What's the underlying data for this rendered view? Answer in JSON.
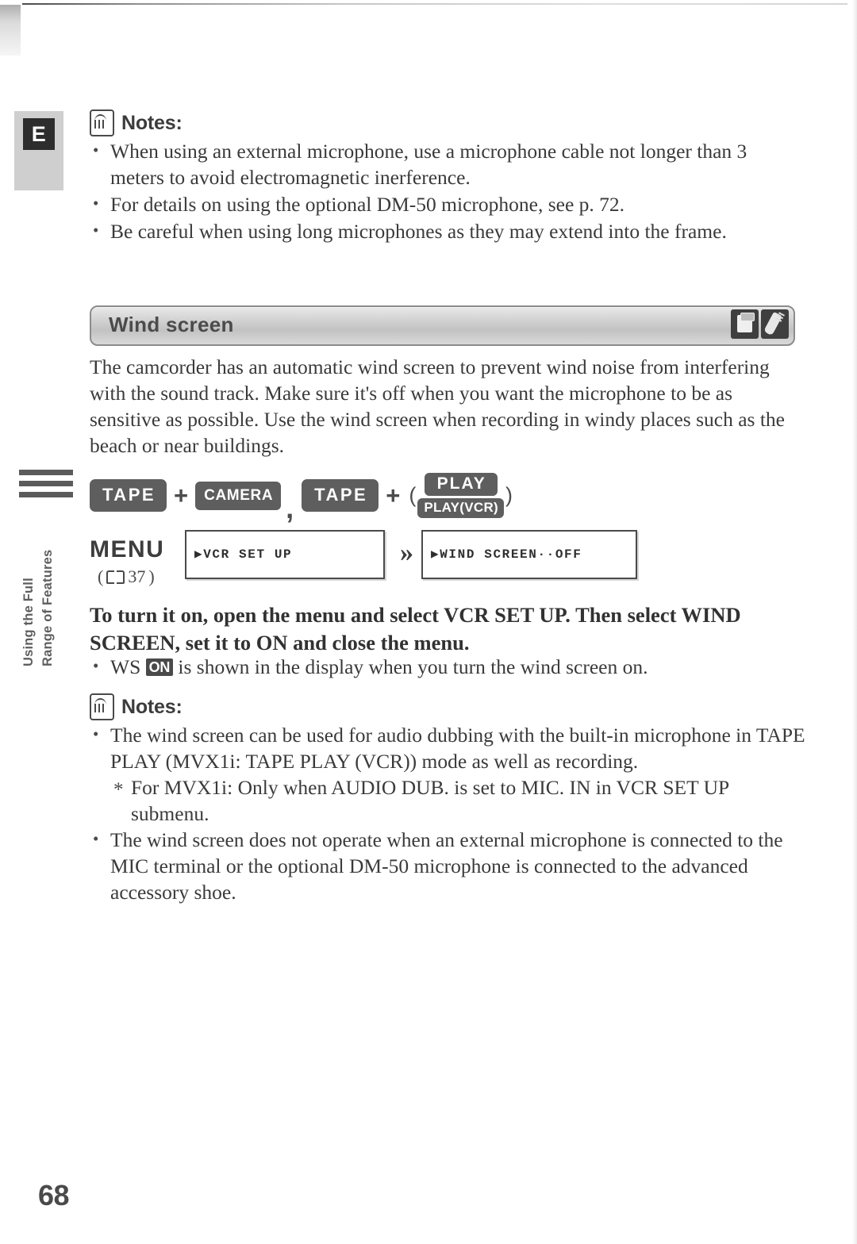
{
  "page": {
    "number": "68",
    "language_badge": "E",
    "side_tab_line1": "Using the Full",
    "side_tab_line2": "Range of Features"
  },
  "notes_top": {
    "heading": "Notes:",
    "icon": "memo-icon",
    "items": [
      "When using an external microphone, use a microphone cable not longer than 3 meters to avoid electromagnetic inerference.",
      "For details on using the optional DM-50 microphone, see p. 72.",
      "Be careful when using long microphones as they may extend into the frame."
    ]
  },
  "section": {
    "title": "Wind screen",
    "mode_icons": [
      "tape-camcorder-icon",
      "remote-wand-icon"
    ]
  },
  "intro": "The camcorder has an automatic wind screen to prevent wind noise from interfering with the sound track. Make sure it's off when you want the microphone to be as sensitive as possible. Use the wind screen when recording in windy places such as the beach or near buildings.",
  "modes": {
    "tape_1": "TAPE",
    "camera": "CAMERA",
    "separator": ",",
    "tape_2": "TAPE",
    "play": "PLAY",
    "play_vcr": "PLAY(VCR)",
    "plus": "+",
    "paren_open": "(",
    "paren_close": ")"
  },
  "menu_flow": {
    "label": "MENU",
    "reference": "37",
    "paren_open": "(",
    "paren_close": ")",
    "step_1": "▶VCR SET UP",
    "step_2": "▶WIND SCREEN··OFF",
    "arrow": "»"
  },
  "instruction": "To turn it on, open the menu and select VCR SET UP. Then select WIND SCREEN, set it to ON and close the menu.",
  "ws_note": {
    "prefix": "WS",
    "badge": "ON",
    "suffix": "is shown in the display when you turn the wind screen on."
  },
  "notes_bottom": {
    "heading": "Notes:",
    "icon": "memo-icon",
    "items": [
      "The wind screen can be used for audio dubbing with the built-in microphone in TAPE PLAY (MVX1i: TAPE PLAY (VCR)) mode as well as recording.",
      "For MVX1i: Only when AUDIO DUB. is set to MIC. IN in VCR SET UP submenu.",
      "The wind screen does not operate when an external microphone is connected to the MIC terminal or the optional DM-50 microphone is connected to the advanced accessory shoe."
    ]
  },
  "colors": {
    "text": "#3a3a3a",
    "badge_gray": "#5e5e5e",
    "bar_border": "#8c8c8c",
    "dark": "#2d2d2d"
  }
}
